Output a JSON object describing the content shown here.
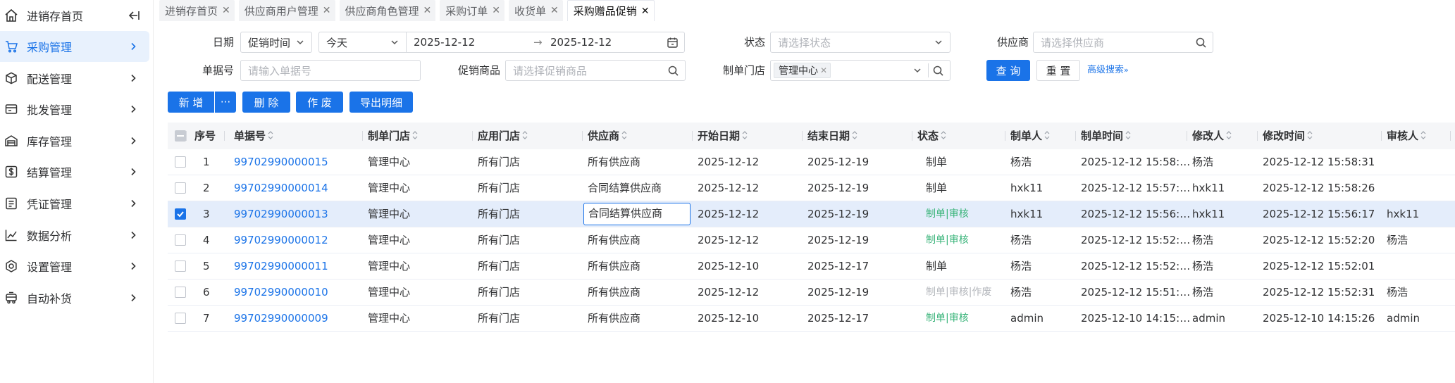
{
  "sidebar": {
    "home": "进销存首页",
    "items": [
      {
        "label": "采购管理",
        "icon": "cart-icon",
        "active": true
      },
      {
        "label": "配送管理",
        "icon": "box-icon",
        "active": false
      },
      {
        "label": "批发管理",
        "icon": "wallet-icon",
        "active": false
      },
      {
        "label": "库存管理",
        "icon": "warehouse-icon",
        "active": false
      },
      {
        "label": "结算管理",
        "icon": "dollar-icon",
        "active": false
      },
      {
        "label": "凭证管理",
        "icon": "voucher-icon",
        "active": false
      },
      {
        "label": "数据分析",
        "icon": "chart-icon",
        "active": false
      },
      {
        "label": "设置管理",
        "icon": "gear-icon",
        "active": false
      },
      {
        "label": "自动补货",
        "icon": "truck-icon",
        "active": false
      }
    ]
  },
  "tabs": [
    {
      "label": "进销存首页",
      "active": false
    },
    {
      "label": "供应商用户管理",
      "active": false
    },
    {
      "label": "供应商角色管理",
      "active": false
    },
    {
      "label": "采购订单",
      "active": false
    },
    {
      "label": "收货单",
      "active": false
    },
    {
      "label": "采购赠品促销",
      "active": true
    }
  ],
  "filters": {
    "date_label": "日期",
    "date_type": "促销时间",
    "date_preset": "今天",
    "date_start": "2025-12-12",
    "date_end": "2025-12-12",
    "status_label": "状态",
    "status_placeholder": "请选择状态",
    "supplier_label": "供应商",
    "supplier_placeholder": "请选择供应商",
    "doc_no_label": "单据号",
    "doc_no_placeholder": "请输入单据号",
    "promo_goods_label": "促销商品",
    "promo_goods_placeholder": "请选择促销商品",
    "store_label": "制单门店",
    "store_tag": "管理中心",
    "query_button": "查 询",
    "reset_button": "重 置",
    "advanced_link": "高级搜索"
  },
  "actions": {
    "add": "新 增",
    "more": "···",
    "delete": "删 除",
    "void": "作 废",
    "export": "导出明细"
  },
  "table": {
    "columns": [
      "序号",
      "单据号",
      "制单门店",
      "应用门店",
      "供应商",
      "开始日期",
      "结束日期",
      "状态",
      "制单人",
      "制单时间",
      "修改人",
      "修改时间",
      "审核人"
    ],
    "rows": [
      {
        "seq": "1",
        "doc_no": "99702990000015",
        "store": "管理中心",
        "apply_store": "所有门店",
        "supplier": "所有供应商",
        "start": "2025-12-12",
        "end": "2025-12-19",
        "status": "制单",
        "status_color": "plain",
        "creator": "杨浩",
        "created": "2025-12-12 15:58:…",
        "modifier": "杨浩",
        "modified": "2025-12-12 15:58:31",
        "auditor": "",
        "checked": false
      },
      {
        "seq": "2",
        "doc_no": "99702990000014",
        "store": "管理中心",
        "apply_store": "所有门店",
        "supplier": "合同结算供应商",
        "start": "2025-12-12",
        "end": "2025-12-19",
        "status": "制单",
        "status_color": "plain",
        "creator": "hxk11",
        "created": "2025-12-12 15:57:…",
        "modifier": "hxk11",
        "modified": "2025-12-12 15:58:26",
        "auditor": "",
        "checked": false
      },
      {
        "seq": "3",
        "doc_no": "99702990000013",
        "store": "管理中心",
        "apply_store": "所有门店",
        "supplier": "合同结算供应商",
        "start": "2025-12-12",
        "end": "2025-12-19",
        "status": "制单|审核",
        "status_color": "green",
        "creator": "hxk11",
        "created": "2025-12-12 15:56:…",
        "modifier": "hxk11",
        "modified": "2025-12-12 15:56:17",
        "auditor": "hxk11",
        "checked": true
      },
      {
        "seq": "4",
        "doc_no": "99702990000012",
        "store": "管理中心",
        "apply_store": "所有门店",
        "supplier": "所有供应商",
        "start": "2025-12-12",
        "end": "2025-12-19",
        "status": "制单|审核",
        "status_color": "green",
        "creator": "杨浩",
        "created": "2025-12-12 15:52:…",
        "modifier": "杨浩",
        "modified": "2025-12-12 15:52:20",
        "auditor": "杨浩",
        "checked": false
      },
      {
        "seq": "5",
        "doc_no": "99702990000011",
        "store": "管理中心",
        "apply_store": "所有门店",
        "supplier": "所有供应商",
        "start": "2025-12-10",
        "end": "2025-12-17",
        "status": "制单",
        "status_color": "plain",
        "creator": "杨浩",
        "created": "2025-12-12 15:52:…",
        "modifier": "杨浩",
        "modified": "2025-12-12 15:52:01",
        "auditor": "",
        "checked": false
      },
      {
        "seq": "6",
        "doc_no": "99702990000010",
        "store": "管理中心",
        "apply_store": "所有门店",
        "supplier": "所有供应商",
        "start": "2025-12-12",
        "end": "2025-12-19",
        "status": "制单|审核|作废",
        "status_color": "gray",
        "creator": "杨浩",
        "created": "2025-12-12 15:51:…",
        "modifier": "杨浩",
        "modified": "2025-12-12 15:52:31",
        "auditor": "杨浩",
        "checked": false
      },
      {
        "seq": "7",
        "doc_no": "99702990000009",
        "store": "管理中心",
        "apply_store": "所有门店",
        "supplier": "所有供应商",
        "start": "2025-12-10",
        "end": "2025-12-17",
        "status": "制单|审核",
        "status_color": "green",
        "creator": "admin",
        "created": "2025-12-10 14:15:…",
        "modifier": "admin",
        "modified": "2025-12-10 14:15:26",
        "auditor": "admin",
        "checked": false
      }
    ]
  },
  "colors": {
    "accent": "#1a73e8",
    "status_green": "#3ab47a",
    "status_gray": "#b4b7bc",
    "selected_row": "#e4edfb"
  }
}
